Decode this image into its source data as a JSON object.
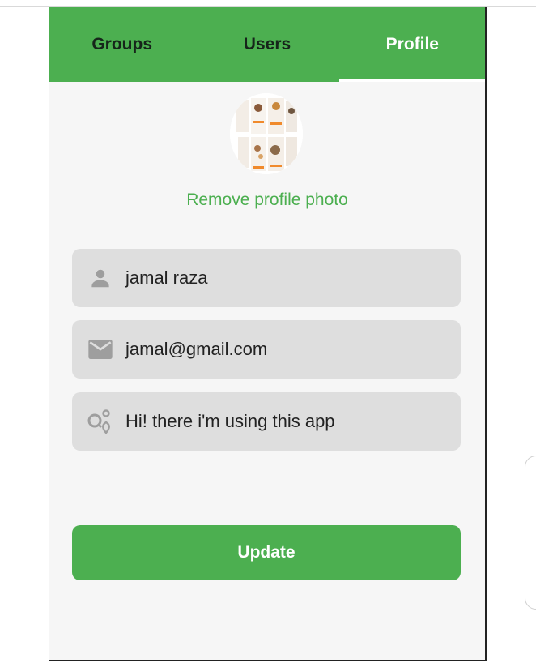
{
  "tabs": [
    {
      "label": "Groups",
      "active": false
    },
    {
      "label": "Users",
      "active": false
    },
    {
      "label": "Profile",
      "active": true
    }
  ],
  "profile": {
    "avatar_icon": "profile-photo",
    "remove_photo_label": "Remove profile photo"
  },
  "fields": {
    "name": {
      "value": "jamal raza",
      "icon": "person-icon"
    },
    "email": {
      "value": "jamal@gmail.com",
      "icon": "mail-icon"
    },
    "status": {
      "value": "Hi! there i'm using this app",
      "icon": "status-icon"
    }
  },
  "update_label": "Update",
  "colors": {
    "accent": "#4caf50",
    "field_bg": "#dedede",
    "page_bg": "#f6f6f6"
  }
}
